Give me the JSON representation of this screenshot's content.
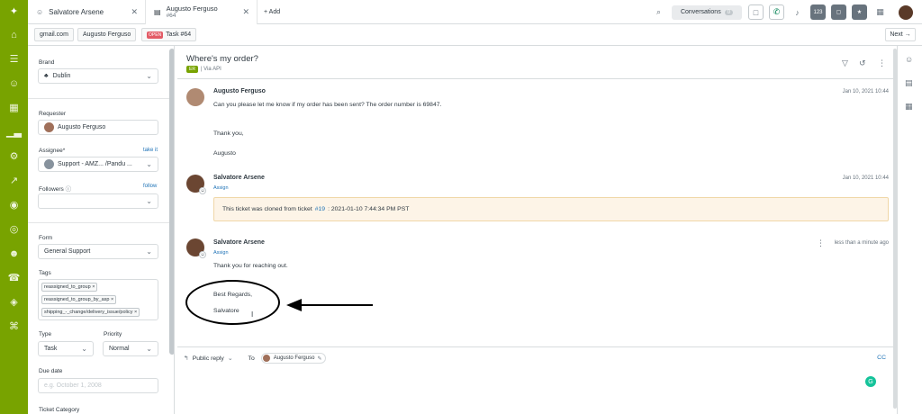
{
  "topbar": {
    "tabs": [
      {
        "label": "Salvatore Arsene"
      },
      {
        "label": "Augusto Ferguso",
        "sublabel": "#64"
      }
    ],
    "add_label": "+ Add",
    "conversations_label": "Conversations",
    "conversations_count": "0",
    "count_badge": "123"
  },
  "subbar": {
    "crumbs": [
      "gmail.com",
      "Augusto Ferguso"
    ],
    "task_badge": "OPEN",
    "task_label": "Task #64",
    "next_label": "Next →"
  },
  "sidebar": {
    "brand_label": "Brand",
    "brand_value": "Dublin",
    "requester_label": "Requester",
    "requester_value": "Augusto Ferguso",
    "assignee_label": "Assignee*",
    "take_it": "take it",
    "assignee_value": "Support - AMZ... /Pandu ...",
    "followers_label": "Followers",
    "follow_link": "follow",
    "form_label": "Form",
    "form_value": "General Support",
    "tags_label": "Tags",
    "tags": [
      "reassigned_to_group ×",
      "reassigned_to_group_by_asp ×",
      "shipping_-_change/delivery_issue/policy ×"
    ],
    "type_label": "Type",
    "type_value": "Task",
    "priority_label": "Priority",
    "priority_value": "Normal",
    "due_label": "Due date",
    "due_placeholder": "e.g. October 1, 2008",
    "category_label": "Ticket Category"
  },
  "ticket": {
    "title": "Where's my order?",
    "channel_badge": "ER",
    "channel": "| Via API"
  },
  "messages": [
    {
      "name": "Augusto Ferguso",
      "time": "Jan 10, 2021 10:44",
      "lines": [
        "Can you please let me know if my order has been sent? The order number is 69847.",
        "Thank you,",
        "Augusto"
      ]
    },
    {
      "name": "Salvatore Arsene",
      "assign": "Assign",
      "time": "Jan 10, 2021 10:44",
      "note_pre": "This ticket was cloned from ticket",
      "note_link": "#19",
      "note_post": ": 2021-01-10 7:44:34 PM PST"
    },
    {
      "name": "Salvatore Arsene",
      "assign": "Assign",
      "time": "less than a minute ago",
      "lines": [
        "Thank you for reaching out.",
        "Best Regards,",
        "Salvatore"
      ]
    }
  ],
  "reply": {
    "mode": "Public reply",
    "to_label": "To",
    "recipient": "Augusto Ferguso",
    "cc": "CC"
  }
}
